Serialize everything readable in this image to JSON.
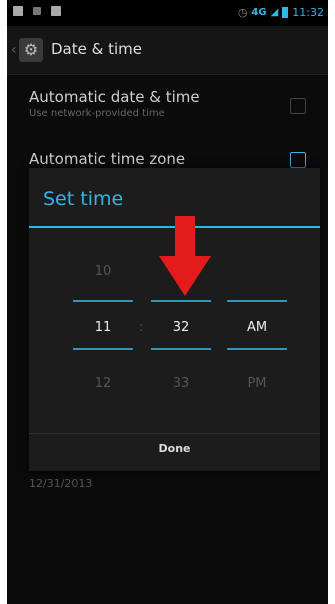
{
  "status_bar": {
    "time": "11:32",
    "network": "4G"
  },
  "action_bar": {
    "title": "Date & time"
  },
  "preferences": {
    "auto_date_time": {
      "title": "Automatic date & time",
      "summary": "Use network-provided time"
    },
    "auto_time_zone": {
      "title": "Automatic time zone"
    },
    "date_value": "12/31/2013"
  },
  "dialog": {
    "title": "Set time",
    "hour": {
      "prev": "10",
      "current": "11",
      "next": "12"
    },
    "minute": {
      "prev": "",
      "current": "32",
      "next": "33"
    },
    "ampm": {
      "current": "AM",
      "next": "PM"
    },
    "separator": ":",
    "done_label": "Done"
  },
  "annotation": {
    "arrow_color": "#e41b1b",
    "arrow_icon": "down-arrow-icon"
  },
  "colors": {
    "accent": "#33b5e5",
    "background": "#0b0b0b",
    "dialog_bg": "#1c1c1c"
  }
}
